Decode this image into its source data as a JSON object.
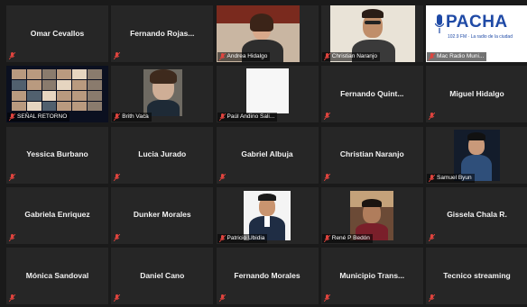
{
  "participants": [
    {
      "name": "Omar Cevallos",
      "video": false
    },
    {
      "name": "Fernando  Rojas...",
      "video": false
    },
    {
      "name": "Andrea Hidalgo",
      "video": true
    },
    {
      "name": "Christian Naranjo",
      "video": true
    },
    {
      "name": "Mac Radio Muni...",
      "video": true,
      "logo_text": "PACHA",
      "logo_sub": "102.9 FM · La radio de la ciudad"
    },
    {
      "name": "SEÑAL RETORNO",
      "video": true
    },
    {
      "name": "Brith Vaca",
      "video": true
    },
    {
      "name": "Paúl Andino Sali...",
      "video": true
    },
    {
      "name": "Fernando  Quint...",
      "video": false
    },
    {
      "name": "Miguel Hidalgo",
      "video": false
    },
    {
      "name": "Yessica Burbano",
      "video": false
    },
    {
      "name": "Lucia Jurado",
      "video": false
    },
    {
      "name": "Gabriel Albuja",
      "video": false
    },
    {
      "name": "Christian Naranjo",
      "video": false
    },
    {
      "name": "Samuel Byun",
      "video": true
    },
    {
      "name": "Gabriela Enriquez",
      "video": false
    },
    {
      "name": "Dunker Morales",
      "video": false
    },
    {
      "name": "Patricio Ubidia",
      "video": true
    },
    {
      "name": "René P Bedón",
      "video": true
    },
    {
      "name": "Gissela Chala R.",
      "video": false
    },
    {
      "name": "Mónica Sandoval",
      "video": false
    },
    {
      "name": "Daniel Cano",
      "video": false
    },
    {
      "name": "Fernando Morales",
      "video": false
    },
    {
      "name": "Municipio  Trans...",
      "video": false
    },
    {
      "name": "Tecnico streaming",
      "video": false
    }
  ],
  "colors": {
    "muted_icon": "#e0443e",
    "tile_bg": "#262626",
    "page_bg": "#1a1a1a",
    "pacha_blue": "#1f4aa6"
  },
  "icons": {
    "muted": "mic-muted-icon"
  }
}
